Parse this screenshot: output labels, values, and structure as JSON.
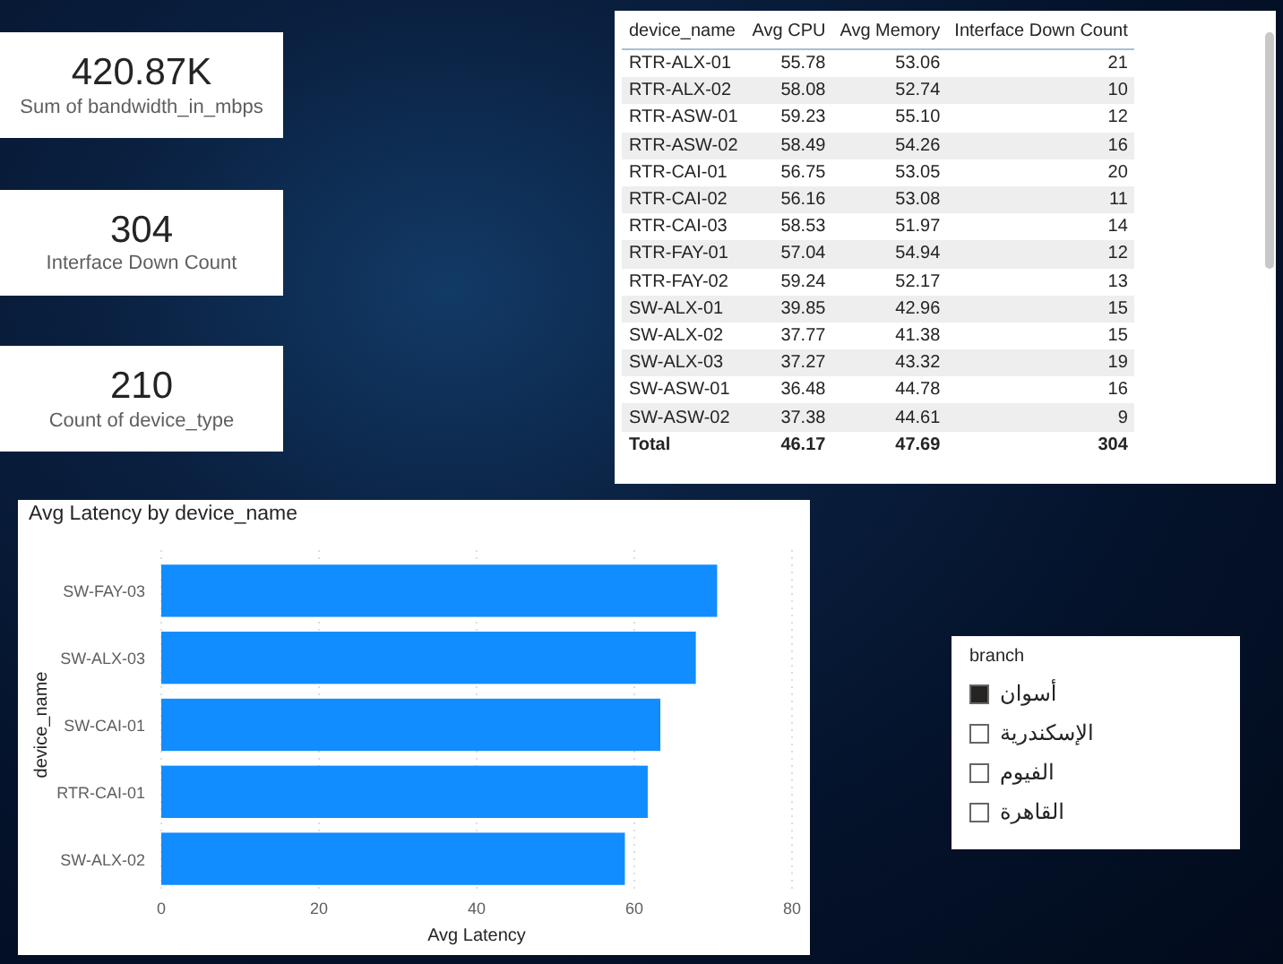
{
  "cards": [
    {
      "value": "420.87K",
      "label": "Sum of bandwidth_in_mbps"
    },
    {
      "value": "304",
      "label": "Interface Down Count"
    },
    {
      "value": "210",
      "label": "Count of device_type"
    }
  ],
  "table": {
    "columns": [
      "device_name",
      "Avg CPU",
      "Avg Memory",
      "Interface Down Count"
    ],
    "rows": [
      [
        "RTR-ALX-01",
        "55.78",
        "53.06",
        "21"
      ],
      [
        "RTR-ALX-02",
        "58.08",
        "52.74",
        "10"
      ],
      [
        "RTR-ASW-01",
        "59.23",
        "55.10",
        "12"
      ],
      [
        "RTR-ASW-02",
        "58.49",
        "54.26",
        "16"
      ],
      [
        "RTR-CAI-01",
        "56.75",
        "53.05",
        "20"
      ],
      [
        "RTR-CAI-02",
        "56.16",
        "53.08",
        "11"
      ],
      [
        "RTR-CAI-03",
        "58.53",
        "51.97",
        "14"
      ],
      [
        "RTR-FAY-01",
        "57.04",
        "54.94",
        "12"
      ],
      [
        "RTR-FAY-02",
        "59.24",
        "52.17",
        "13"
      ],
      [
        "SW-ALX-01",
        "39.85",
        "42.96",
        "15"
      ],
      [
        "SW-ALX-02",
        "37.77",
        "41.38",
        "15"
      ],
      [
        "SW-ALX-03",
        "37.27",
        "43.32",
        "19"
      ],
      [
        "SW-ASW-01",
        "36.48",
        "44.78",
        "16"
      ],
      [
        "SW-ASW-02",
        "37.38",
        "44.61",
        "9"
      ]
    ],
    "total": [
      "Total",
      "46.17",
      "47.69",
      "304"
    ]
  },
  "chart": {
    "title": "Avg Latency by device_name",
    "chart_data": {
      "type": "bar",
      "orientation": "horizontal",
      "xlabel": "Avg Latency",
      "ylabel": "device_name",
      "categories": [
        "SW-FAY-03",
        "SW-ALX-03",
        "SW-CAI-01",
        "RTR-CAI-01",
        "SW-ALX-02"
      ],
      "series": [
        {
          "color": "#118dff",
          "values": [
            70.5,
            67.8,
            63.3,
            61.7,
            58.8
          ]
        }
      ],
      "xlim": [
        0,
        80
      ],
      "xticks": [
        0,
        20,
        40,
        60,
        80
      ],
      "grid": true
    }
  },
  "slicer": {
    "title": "branch",
    "items": [
      {
        "label": "أسوان",
        "checked": true
      },
      {
        "label": "الإسكندرية",
        "checked": false
      },
      {
        "label": "الفيوم",
        "checked": false
      },
      {
        "label": "القاهرة",
        "checked": false
      }
    ]
  }
}
